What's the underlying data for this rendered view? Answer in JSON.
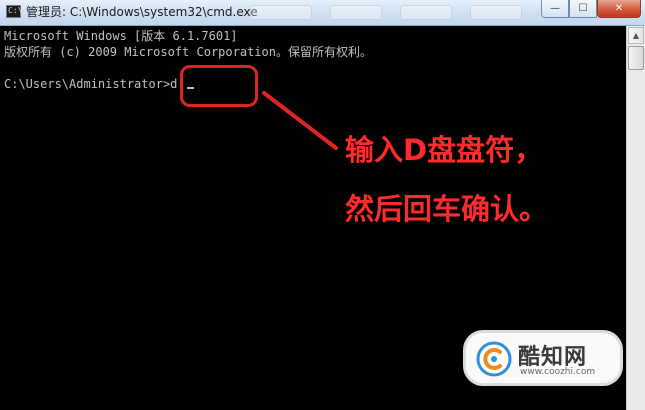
{
  "window": {
    "title": "管理员: C:\\Windows\\system32\\cmd.exe",
    "icon": "cmd-icon",
    "icon_glyph": "C:\\"
  },
  "controls": {
    "minimize": "—",
    "maximize": "☐",
    "close": "✕"
  },
  "console": {
    "lines": [
      "Microsoft Windows [版本 6.1.7601]",
      "版权所有 (c) 2009 Microsoft Corporation。保留所有权利。",
      "",
      "C:\\Users\\Administrator>d:"
    ]
  },
  "annotation": {
    "line1": "输入D盘盘符，",
    "line2": "然后回车确认。",
    "color": "#e02424"
  },
  "watermark": {
    "name": "酷知网",
    "url": "www.coozhi.com"
  },
  "scrollbar": {
    "up": "▲"
  }
}
